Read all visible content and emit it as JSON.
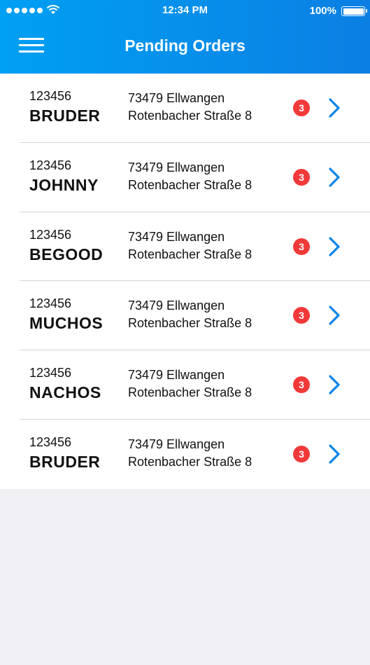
{
  "status_bar": {
    "time": "12:34 PM",
    "battery": "100%"
  },
  "header": {
    "title": "Pending Orders",
    "menu_icon": "hamburger-menu-icon"
  },
  "colors": {
    "header_start": "#00a0f4",
    "header_end": "#0b7fe3",
    "badge": "#f2393a",
    "chevron": "#0b84e8"
  },
  "orders": [
    {
      "number": "123456",
      "name": "BRUDER",
      "address_line1": "73479 Ellwangen",
      "address_line2": "Rotenbacher Straße 8",
      "badge": "3"
    },
    {
      "number": "123456",
      "name": "JOHNNY",
      "address_line1": "73479 Ellwangen",
      "address_line2": "Rotenbacher Straße 8",
      "badge": "3"
    },
    {
      "number": "123456",
      "name": "BEGOOD",
      "address_line1": "73479 Ellwangen",
      "address_line2": "Rotenbacher Straße 8",
      "badge": "3"
    },
    {
      "number": "123456",
      "name": "MUCHOS",
      "address_line1": "73479 Ellwangen",
      "address_line2": "Rotenbacher Straße 8",
      "badge": "3"
    },
    {
      "number": "123456",
      "name": "NACHOS",
      "address_line1": "73479 Ellwangen",
      "address_line2": "Rotenbacher Straße 8",
      "badge": "3"
    },
    {
      "number": "123456",
      "name": "BRUDER",
      "address_line1": "73479 Ellwangen",
      "address_line2": "Rotenbacher Straße 8",
      "badge": "3"
    }
  ]
}
